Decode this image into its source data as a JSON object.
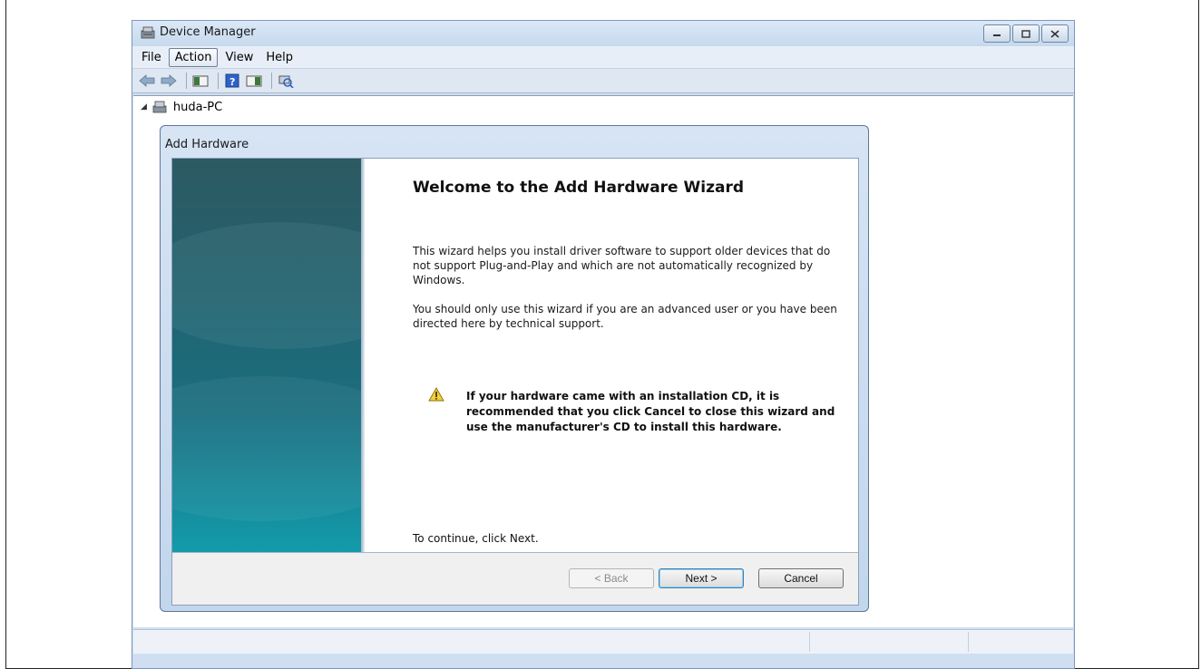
{
  "window": {
    "title": "Device Manager"
  },
  "menu": {
    "items": [
      "File",
      "Action",
      "View",
      "Help"
    ]
  },
  "tree": {
    "root_label": "huda-PC"
  },
  "dialog": {
    "title": "Add Hardware",
    "heading": "Welcome to the Add Hardware Wizard",
    "para1": "This wizard helps you install driver software to support older devices that do not support Plug-and-Play and which are not automatically recognized by Windows.",
    "para2": "You should only use this wizard if you are an advanced user or you have been directed here by technical support.",
    "warning": "If your hardware came with an installation CD, it is recommended that you click Cancel to close this wizard and use the manufacturer's CD to install this hardware.",
    "continue_text": "To continue, click Next.",
    "buttons": {
      "back": "< Back",
      "next": "Next >",
      "cancel": "Cancel"
    }
  }
}
